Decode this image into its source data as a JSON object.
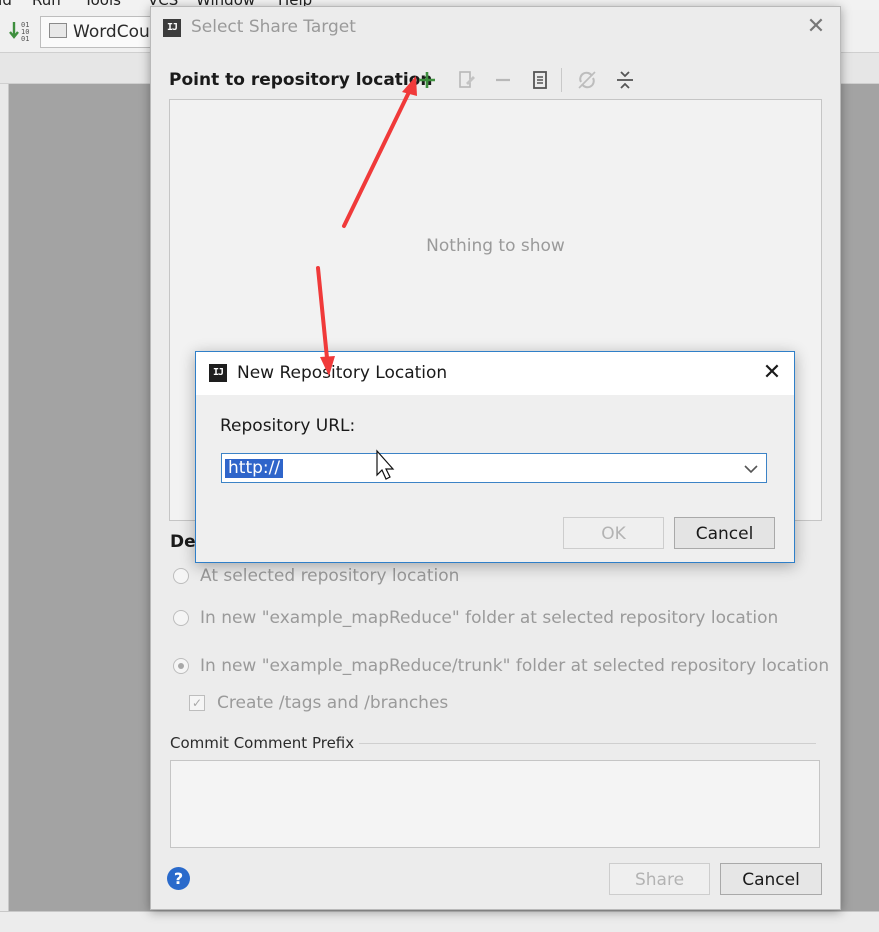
{
  "ide": {
    "menu_items": [
      "ild",
      "Run",
      "Tools",
      "VCS",
      "Window",
      "Help"
    ],
    "run_config": "WordCou"
  },
  "share_dialog": {
    "title": "Select Share Target",
    "section_label": "Point to repository location",
    "toolbar_icons": [
      "add-icon",
      "edit-icon",
      "remove-icon",
      "browse-icon",
      "refresh-icon",
      "collapse-icon"
    ],
    "empty_text": "Nothing to show",
    "define_label": "Def",
    "options": [
      {
        "label": "At selected repository location",
        "checked": false
      },
      {
        "label": "In new \"example_mapReduce\" folder at selected repository location",
        "checked": false
      },
      {
        "label": "In new \"example_mapReduce/trunk\" folder at selected repository location",
        "checked": true
      }
    ],
    "create_tags_label": "Create /tags and /branches",
    "create_tags_checked": true,
    "commit_label": "Commit Comment Prefix",
    "commit_value": "",
    "help_label": "?",
    "share_label": "Share",
    "cancel_label": "Cancel"
  },
  "repo_dialog": {
    "title": "New Repository Location",
    "url_label": "Repository URL:",
    "url_value": "http://",
    "ok_label": "OK",
    "cancel_label": "Cancel"
  },
  "colors": {
    "annotation_arrow": "#f03a3a",
    "add_icon": "#3e8f3e",
    "focus_border": "#3c83c6",
    "selection": "#2f65ca",
    "help": "#2a6acb"
  }
}
